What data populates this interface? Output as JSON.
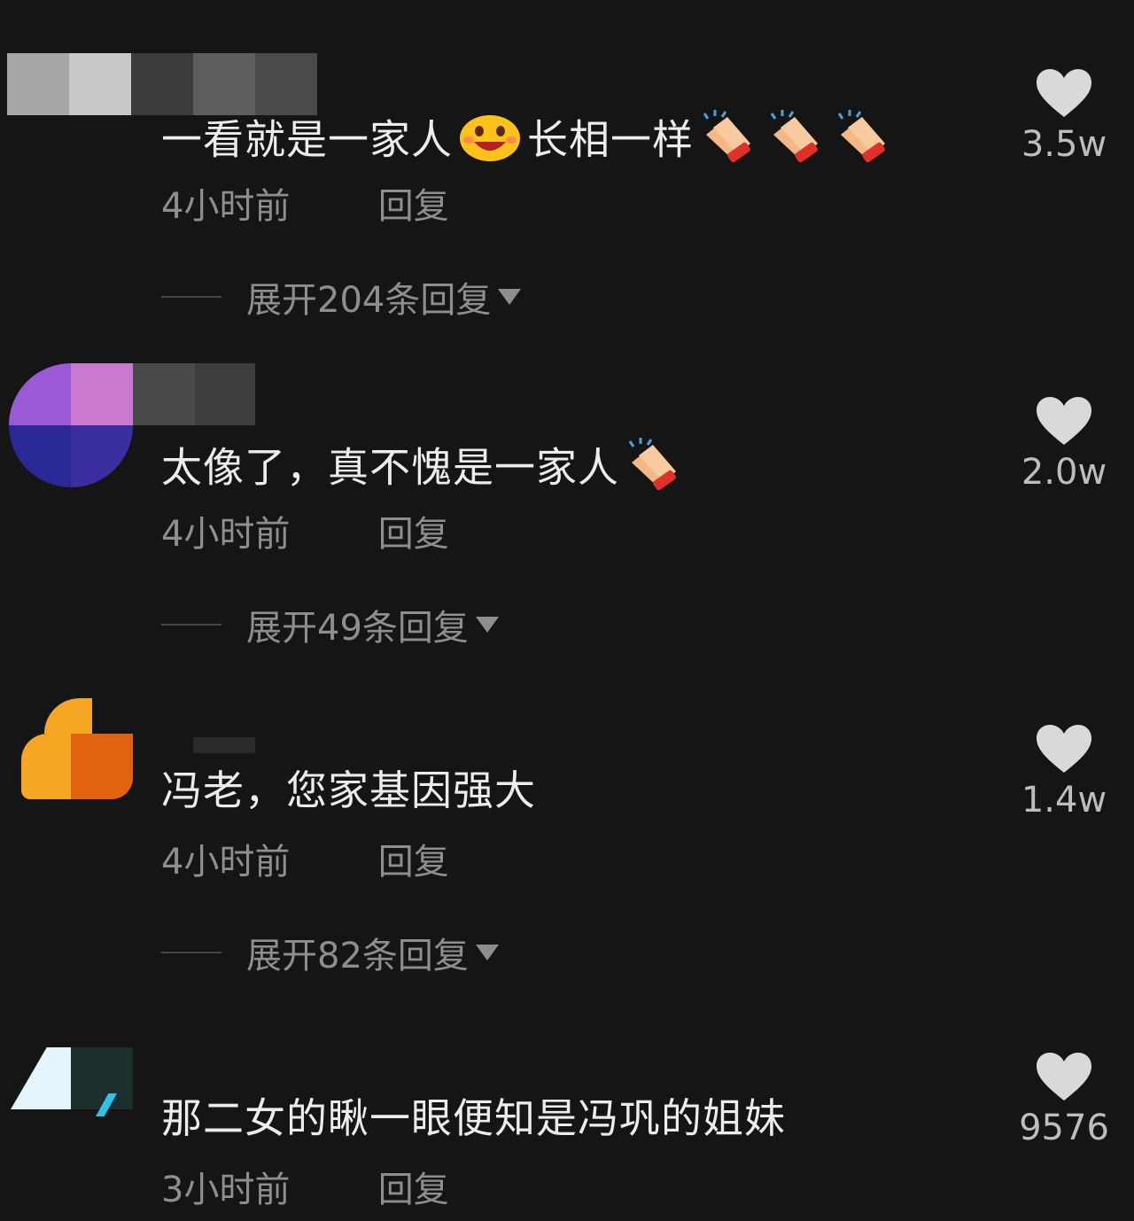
{
  "comments": [
    {
      "text_a": "一看就是一家人",
      "text_b": "长相一样",
      "emojis": [
        "laughing-face-emoji",
        "clapping-hands-emoji",
        "clapping-hands-emoji",
        "clapping-hands-emoji"
      ],
      "time": "4小时前",
      "reply_label": "回复",
      "expand_label": "展开204条回复",
      "likes": "3.5w"
    },
    {
      "text_a": "太像了，真不愧是一家人",
      "emojis": [
        "clapping-hands-emoji"
      ],
      "time": "4小时前",
      "reply_label": "回复",
      "expand_label": "展开49条回复",
      "likes": "2.0w"
    },
    {
      "text_a": "冯老，您家基因强大",
      "time": "4小时前",
      "reply_label": "回复",
      "expand_label": "展开82条回复",
      "likes": "1.4w"
    },
    {
      "text_a": "那二女的瞅一眼便知是冯巩的姐妹",
      "time": "3小时前",
      "reply_label": "回复",
      "likes": "9576"
    }
  ],
  "colors": {
    "background": "#161515",
    "text_primary": "#ececec",
    "text_secondary": "#8e8e8e",
    "heart": "#d9d9d9"
  },
  "icons": [
    "heart-icon",
    "caret-down-icon"
  ]
}
